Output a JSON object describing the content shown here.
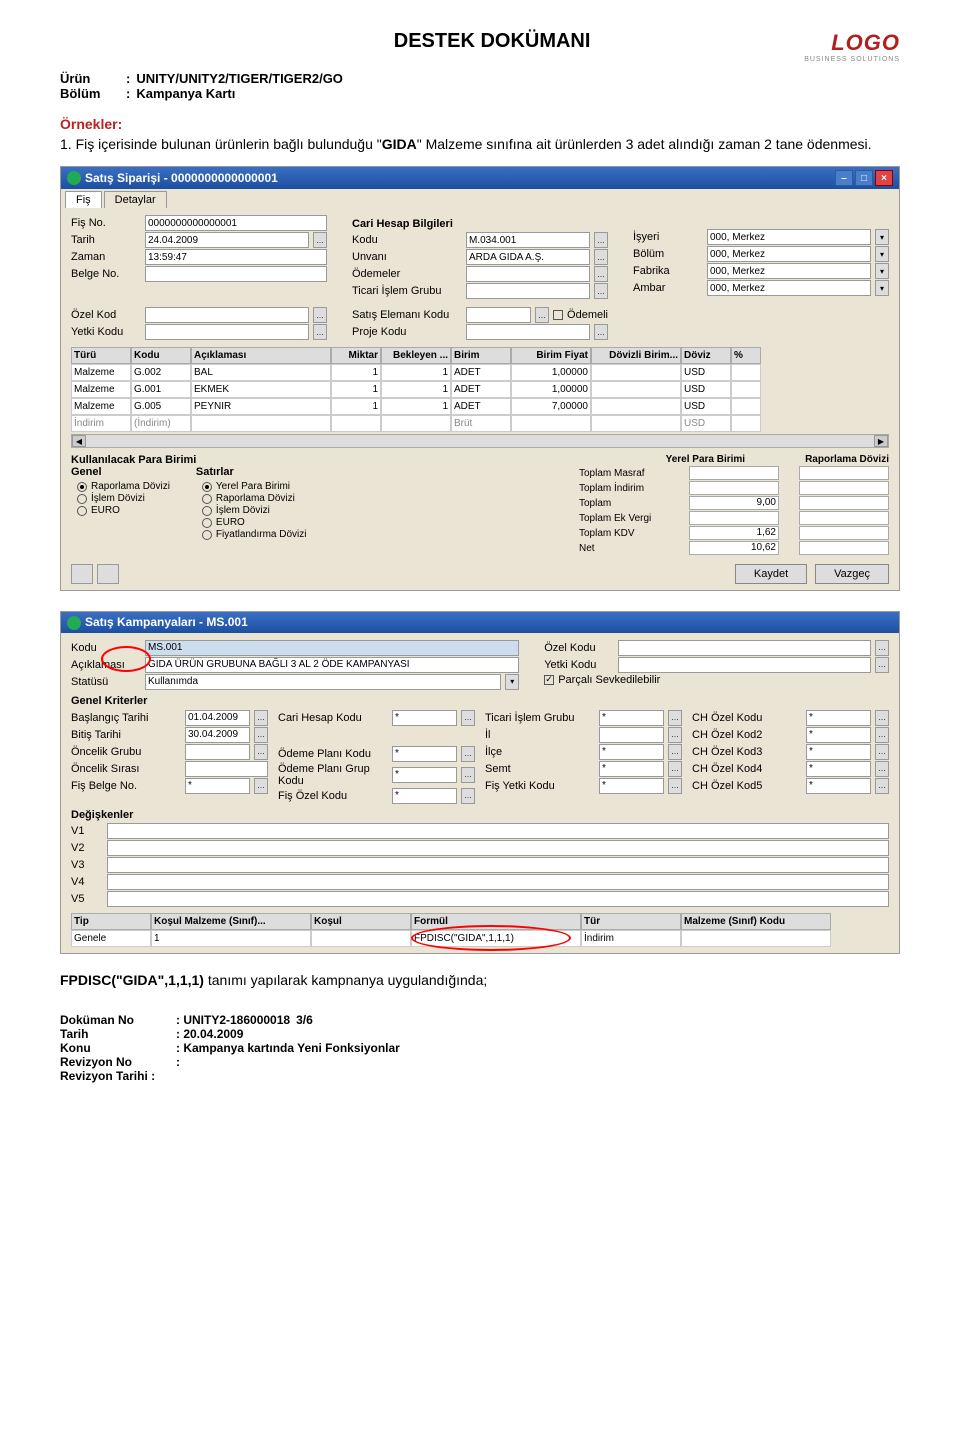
{
  "logo": {
    "main": "LOGO",
    "sub": "BUSINESS SOLUTIONS"
  },
  "doc": {
    "title": "DESTEK DOKÜMANI",
    "urun_label": "Ürün",
    "urun_value": "UNITY/UNITY2/TIGER/TIGER2/GO",
    "bolum_label": "Bölüm",
    "bolum_value": "Kampanya Kartı",
    "colon": ":"
  },
  "examples_title": "Örnekler:",
  "example1_pre": "1. Fiş içerisinde bulunan ürünlerin bağlı bulunduğu \"",
  "example1_bold": "GIDA",
  "example1_post": "\" Malzeme sınıfına ait ürünlerden 3 adet alındığı zaman 2 tane ödenmesi.",
  "win1": {
    "title": "Satış Siparişi - 0000000000000001",
    "tabs": [
      "Fiş",
      "Detaylar"
    ],
    "fis": {
      "no_label": "Fiş No.",
      "no": "0000000000000001",
      "tarih_label": "Tarih",
      "tarih": "24.04.2009",
      "zaman_label": "Zaman",
      "zaman": "13:59:47",
      "belge_label": "Belge No.",
      "belge": ""
    },
    "cari_title": "Cari Hesap Bilgileri",
    "cari": {
      "kodu_label": "Kodu",
      "kodu": "M.034.001",
      "unvan_label": "Unvanı",
      "unvan": "ARDA GIDA A.Ş.",
      "odeme_label": "Ödemeler",
      "odeme": "",
      "tig_label": "Ticari İşlem Grubu",
      "tig": ""
    },
    "right": {
      "isyeri_label": "İşyeri",
      "isyeri": "000, Merkez",
      "bolum_label": "Bölüm",
      "bolum": "000, Merkez",
      "fabrika_label": "Fabrika",
      "fabrika": "000, Merkez",
      "ambar_label": "Ambar",
      "ambar": "000, Merkez"
    },
    "extra": {
      "ozel_label": "Özel Kod",
      "yetki_label": "Yetki Kodu",
      "satis_label": "Satış Elemanı Kodu",
      "proje_label": "Proje Kodu",
      "odemeli_label": "Ödemeli"
    },
    "cols": [
      "Türü",
      "Kodu",
      "Açıklaması",
      "Miktar",
      "Bekleyen ...",
      "Birim",
      "Birim Fiyat",
      "Dövizli Birim...",
      "Döviz",
      "%"
    ],
    "rows": [
      {
        "turu": "Malzeme",
        "kodu": "G.002",
        "acik": "BAL",
        "mik": "1",
        "bek": "1",
        "bir": "ADET",
        "bf": "1,00000",
        "dov": "",
        "dv": "USD"
      },
      {
        "turu": "Malzeme",
        "kodu": "G.001",
        "acik": "EKMEK",
        "mik": "1",
        "bek": "1",
        "bir": "ADET",
        "bf": "1,00000",
        "dov": "",
        "dv": "USD"
      },
      {
        "turu": "Malzeme",
        "kodu": "G.005",
        "acik": "PEYNIR",
        "mik": "1",
        "bek": "1",
        "bir": "ADET",
        "bf": "7,00000",
        "dov": "",
        "dv": "USD"
      }
    ],
    "indirim_row": {
      "turu": "İndirim",
      "kodu": "(İndirim)",
      "bir": "Brüt",
      "dv": "USD"
    },
    "kpb_title": "Kullanılacak Para Birimi",
    "genel_title": "Genel",
    "genel": [
      "Raporlama Dövizi",
      "İşlem Dövizi",
      "EURO"
    ],
    "satirlar_title": "Satırlar",
    "satirlar": [
      "Yerel Para Birimi",
      "Raporlama Dövizi",
      "İşlem Dövizi",
      "EURO",
      "Fiyatlandırma Dövizi"
    ],
    "totals_head": [
      "Yerel Para Birimi",
      "Raporlama Dövizi"
    ],
    "totals": [
      {
        "l": "Toplam Masraf",
        "v": ""
      },
      {
        "l": "Toplam İndirim",
        "v": ""
      },
      {
        "l": "Toplam",
        "v": "9,00"
      },
      {
        "l": "Toplam Ek Vergi",
        "v": ""
      },
      {
        "l": "Toplam KDV",
        "v": "1,62"
      },
      {
        "l": "Net",
        "v": "10,62"
      }
    ],
    "kaydet": "Kaydet",
    "vazgec": "Vazgeç"
  },
  "win2": {
    "title": "Satış Kampanyaları - MS.001",
    "top": {
      "kodu_label": "Kodu",
      "kodu": "MS.001",
      "acik_label": "Açıklaması",
      "acik": "GIDA ÜRÜN GRUBUNA BAĞLI 3 AL 2 ÖDE KAMPANYASI",
      "statu_label": "Statüsü",
      "statu": "Kullanımda",
      "ozel_label": "Özel Kodu",
      "yetki_label": "Yetki Kodu",
      "parcali_label": "Parçalı Sevkedilebilir"
    },
    "gk_title": "Genel Kriterler",
    "gk": {
      "bas_label": "Başlangıç Tarihi",
      "bas": "01.04.2009",
      "bit_label": "Bitiş Tarihi",
      "bit": "30.04.2009",
      "onc_label": "Öncelik Grubu",
      "onc": "",
      "sira_label": "Öncelik Sırası",
      "sira": "",
      "fbn_label": "Fiş Belge No.",
      "fbn": "*",
      "chk_label": "Cari Hesap Kodu",
      "chk": "*",
      "opk_label": "Ödeme Planı Kodu",
      "opk": "*",
      "opgk_label": "Ödeme Planı Grup Kodu",
      "opgk": "*",
      "fok_label": "Fiş Özel Kodu",
      "fok": "*",
      "tig_label": "Ticari İşlem Grubu",
      "tig": "*",
      "il_label": "İl",
      "il": "",
      "ilce_label": "İlçe",
      "ilce": "*",
      "semt_label": "Semt",
      "semt": "*",
      "fyk_label": "Fiş Yetki Kodu",
      "fyk": "*",
      "cho1_label": "CH Özel Kodu",
      "cho1": "*",
      "cho2_label": "CH Özel Kod2",
      "cho2": "*",
      "cho3_label": "CH Özel Kod3",
      "cho3": "*",
      "cho4_label": "CH Özel Kod4",
      "cho4": "*",
      "cho5_label": "CH Özel Kod5",
      "cho5": "*"
    },
    "deg_title": "Değişkenler",
    "deg": [
      "V1",
      "V2",
      "V3",
      "V4",
      "V5"
    ],
    "grid_cols": [
      "Tip",
      "Koşul Malzeme (Sınıf)...",
      "Koşul",
      "Formül",
      "Tür",
      "Malzeme (Sınıf) Kodu"
    ],
    "grid_row": {
      "tip": "Genele",
      "kms": "1",
      "kos": "",
      "for": "FPDISC(\"GIDA\",1,1,1)",
      "tur": "İndirim",
      "msk": ""
    }
  },
  "after_text_pre": "FPDISC(\"GIDA\",1,1,1)",
  "after_text_post": " tanımı yapılarak kampnanya uygulandığında;",
  "footer": {
    "dno_label": "Doküman No",
    "dno": ": UNITY2-186000018",
    "tarih_label": "Tarih",
    "tarih": ": 20.04.2009",
    "konu_label": "Konu",
    "konu": ": Kampanya kartında Yeni Fonksiyonlar",
    "rno_label": "Revizyon No",
    "rno": ":",
    "rt_label": "Revizyon Tarihi :",
    "rt": "",
    "page": "3/6"
  }
}
